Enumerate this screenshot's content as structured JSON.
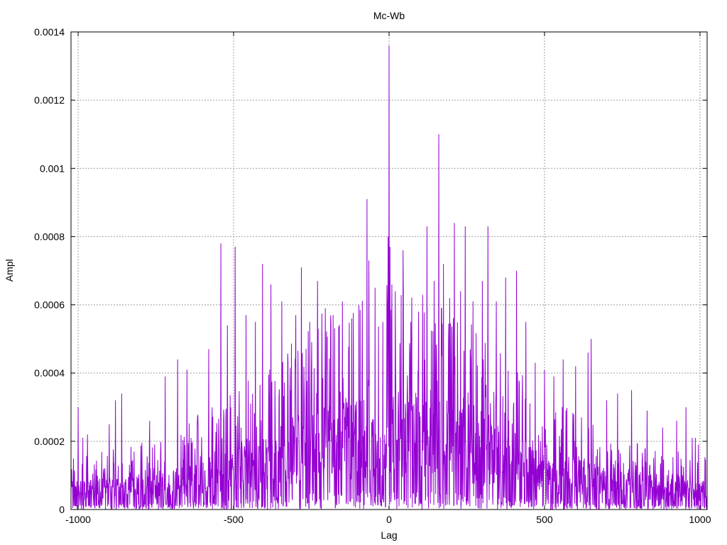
{
  "chart_data": {
    "type": "line",
    "title": "Mc-Wb",
    "xlabel": "Lag",
    "ylabel": "Ampl",
    "xlim": [
      -1023,
      1023
    ],
    "ylim": [
      0,
      0.0014
    ],
    "grid": true,
    "legend": "none",
    "line_color": "#9400d3",
    "xticks": [
      {
        "value": -1000,
        "label": "-1000"
      },
      {
        "value": -500,
        "label": "-500"
      },
      {
        "value": 0,
        "label": "0"
      },
      {
        "value": 500,
        "label": "500"
      },
      {
        "value": 1000,
        "label": "1000"
      }
    ],
    "yticks": [
      {
        "value": 0,
        "label": "0"
      },
      {
        "value": 0.0002,
        "label": "0.0002"
      },
      {
        "value": 0.0004,
        "label": "0.0004"
      },
      {
        "value": 0.0006,
        "label": "0.0006"
      },
      {
        "value": 0.0008,
        "label": "0.0008"
      },
      {
        "value": 0.001,
        "label": "0.001"
      },
      {
        "value": 0.0012,
        "label": "0.0012"
      },
      {
        "value": 0.0014,
        "label": "0.0014"
      }
    ],
    "peaks": [
      {
        "x": -1000,
        "y": 0.0003
      },
      {
        "x": -985,
        "y": 0.00021
      },
      {
        "x": -970,
        "y": 0.00022
      },
      {
        "x": -900,
        "y": 0.00025
      },
      {
        "x": -880,
        "y": 0.00032
      },
      {
        "x": -860,
        "y": 0.00034
      },
      {
        "x": -770,
        "y": 0.00026
      },
      {
        "x": -720,
        "y": 0.00039
      },
      {
        "x": -680,
        "y": 0.00044
      },
      {
        "x": -650,
        "y": 0.00041
      },
      {
        "x": -580,
        "y": 0.00047
      },
      {
        "x": -541,
        "y": 0.00078
      },
      {
        "x": -520,
        "y": 0.00054
      },
      {
        "x": -495,
        "y": 0.00077
      },
      {
        "x": -460,
        "y": 0.00057
      },
      {
        "x": -430,
        "y": 0.00055
      },
      {
        "x": -407,
        "y": 0.00072
      },
      {
        "x": -380,
        "y": 0.00066
      },
      {
        "x": -345,
        "y": 0.00061
      },
      {
        "x": -300,
        "y": 0.00057
      },
      {
        "x": -282,
        "y": 0.00071
      },
      {
        "x": -255,
        "y": 0.00055
      },
      {
        "x": -230,
        "y": 0.00067
      },
      {
        "x": -205,
        "y": 0.00059
      },
      {
        "x": -180,
        "y": 0.00057
      },
      {
        "x": -150,
        "y": 0.00061
      },
      {
        "x": -120,
        "y": 0.00056
      },
      {
        "x": -97,
        "y": 0.0006
      },
      {
        "x": -71,
        "y": 0.00091
      },
      {
        "x": -65,
        "y": 0.00073
      },
      {
        "x": -45,
        "y": 0.00065
      },
      {
        "x": -20,
        "y": 0.00055
      },
      {
        "x": -3,
        "y": 0.0008
      },
      {
        "x": 0,
        "y": 0.00136
      },
      {
        "x": 3,
        "y": 0.00077
      },
      {
        "x": 20,
        "y": 0.00064
      },
      {
        "x": 45,
        "y": 0.00076
      },
      {
        "x": 70,
        "y": 0.00055
      },
      {
        "x": 95,
        "y": 0.00058
      },
      {
        "x": 122,
        "y": 0.00083
      },
      {
        "x": 145,
        "y": 0.00067
      },
      {
        "x": 160,
        "y": 0.0011
      },
      {
        "x": 175,
        "y": 0.00072
      },
      {
        "x": 195,
        "y": 0.00062
      },
      {
        "x": 210,
        "y": 0.00084
      },
      {
        "x": 230,
        "y": 0.00064
      },
      {
        "x": 245,
        "y": 0.00083
      },
      {
        "x": 270,
        "y": 0.00061
      },
      {
        "x": 300,
        "y": 0.00067
      },
      {
        "x": 318,
        "y": 0.00083
      },
      {
        "x": 345,
        "y": 0.00061
      },
      {
        "x": 375,
        "y": 0.00068
      },
      {
        "x": 410,
        "y": 0.0007
      },
      {
        "x": 440,
        "y": 0.00055
      },
      {
        "x": 470,
        "y": 0.00043
      },
      {
        "x": 500,
        "y": 0.00041
      },
      {
        "x": 530,
        "y": 0.00039
      },
      {
        "x": 560,
        "y": 0.00044
      },
      {
        "x": 600,
        "y": 0.00042
      },
      {
        "x": 640,
        "y": 0.00046
      },
      {
        "x": 650,
        "y": 0.0005
      },
      {
        "x": 700,
        "y": 0.00032
      },
      {
        "x": 735,
        "y": 0.00034
      },
      {
        "x": 780,
        "y": 0.00035
      },
      {
        "x": 830,
        "y": 0.00029
      },
      {
        "x": 880,
        "y": 0.00024
      },
      {
        "x": 925,
        "y": 0.00026
      },
      {
        "x": 955,
        "y": 0.0003
      },
      {
        "x": 975,
        "y": 0.00021
      },
      {
        "x": 985,
        "y": 0.00021
      },
      {
        "x": 995,
        "y": 0.00019
      }
    ]
  }
}
